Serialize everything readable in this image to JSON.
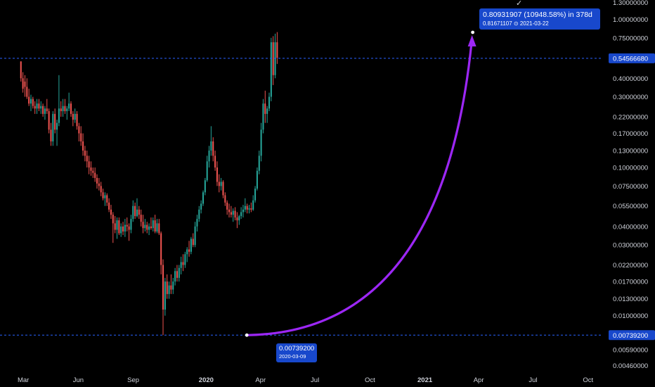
{
  "colors": {
    "background": "#000000",
    "up": "#26a69a",
    "down": "#ef5350",
    "arrow": "#9c27f5",
    "guide": "#2962ff",
    "axis_text": "#d1d4dc",
    "label_bg": "#1848cc"
  },
  "icons": {
    "top_marker": "check-icon"
  },
  "chart_data": {
    "type": "candlestick",
    "scale": "log",
    "y_axis_position": "right",
    "ylim": [
      0.0042,
      1.35
    ],
    "y_ticks": [
      {
        "value": 1.3,
        "label": "1.30000000"
      },
      {
        "value": 1.0,
        "label": "1.00000000"
      },
      {
        "value": 0.75,
        "label": "0.75000000"
      },
      {
        "value": 0.4,
        "label": "0.40000000"
      },
      {
        "value": 0.3,
        "label": "0.30000000"
      },
      {
        "value": 0.22,
        "label": "0.22000000"
      },
      {
        "value": 0.17,
        "label": "0.17000000"
      },
      {
        "value": 0.13,
        "label": "0.13000000"
      },
      {
        "value": 0.1,
        "label": "0.10000000"
      },
      {
        "value": 0.075,
        "label": "0.07500000"
      },
      {
        "value": 0.055,
        "label": "0.05500000"
      },
      {
        "value": 0.04,
        "label": "0.04000000"
      },
      {
        "value": 0.03,
        "label": "0.03000000"
      },
      {
        "value": 0.022,
        "label": "0.02200000"
      },
      {
        "value": 0.017,
        "label": "0.01700000"
      },
      {
        "value": 0.013,
        "label": "0.01300000"
      },
      {
        "value": 0.01,
        "label": "0.01000000"
      },
      {
        "value": 0.0059,
        "label": "0.00590000"
      },
      {
        "value": 0.0046,
        "label": "0.00460000"
      }
    ],
    "x_range": [
      "2019-01-21",
      "2021-10-26"
    ],
    "x_ticks": [
      {
        "date": "2019-03-01",
        "label": "Mar",
        "bold": false
      },
      {
        "date": "2019-06-01",
        "label": "Jun",
        "bold": false
      },
      {
        "date": "2019-09-01",
        "label": "Sep",
        "bold": false
      },
      {
        "date": "2020-01-01",
        "label": "2020",
        "bold": true
      },
      {
        "date": "2020-04-01",
        "label": "Apr",
        "bold": false
      },
      {
        "date": "2020-07-01",
        "label": "Jul",
        "bold": false
      },
      {
        "date": "2020-10-01",
        "label": "Oct",
        "bold": false
      },
      {
        "date": "2021-01-01",
        "label": "2021",
        "bold": true
      },
      {
        "date": "2021-04-01",
        "label": "Apr",
        "bold": false
      },
      {
        "date": "2021-07-01",
        "label": "Jul",
        "bold": false
      },
      {
        "date": "2021-10-01",
        "label": "Oct",
        "bold": false
      }
    ],
    "start_date": "2019-02-25",
    "interval_days": 3.35,
    "ohlc": [
      [
        0.52,
        0.52,
        0.38,
        0.4
      ],
      [
        0.4,
        0.44,
        0.32,
        0.34
      ],
      [
        0.38,
        0.42,
        0.3,
        0.35
      ],
      [
        0.35,
        0.4,
        0.29,
        0.3
      ],
      [
        0.3,
        0.34,
        0.26,
        0.27
      ],
      [
        0.27,
        0.31,
        0.24,
        0.29
      ],
      [
        0.29,
        0.3,
        0.25,
        0.26
      ],
      [
        0.26,
        0.28,
        0.23,
        0.25
      ],
      [
        0.25,
        0.29,
        0.23,
        0.27
      ],
      [
        0.27,
        0.29,
        0.24,
        0.25
      ],
      [
        0.25,
        0.28,
        0.23,
        0.26
      ],
      [
        0.26,
        0.27,
        0.22,
        0.23
      ],
      [
        0.23,
        0.26,
        0.21,
        0.25
      ],
      [
        0.25,
        0.29,
        0.23,
        0.24
      ],
      [
        0.24,
        0.25,
        0.17,
        0.18
      ],
      [
        0.18,
        0.2,
        0.14,
        0.15
      ],
      [
        0.15,
        0.24,
        0.14,
        0.23
      ],
      [
        0.23,
        0.25,
        0.17,
        0.18
      ],
      [
        0.18,
        0.21,
        0.14,
        0.2
      ],
      [
        0.2,
        0.42,
        0.19,
        0.25
      ],
      [
        0.25,
        0.28,
        0.22,
        0.24
      ],
      [
        0.24,
        0.29,
        0.22,
        0.26
      ],
      [
        0.26,
        0.29,
        0.23,
        0.24
      ],
      [
        0.24,
        0.26,
        0.21,
        0.25
      ],
      [
        0.25,
        0.32,
        0.24,
        0.27
      ],
      [
        0.27,
        0.28,
        0.22,
        0.23
      ],
      [
        0.23,
        0.24,
        0.19,
        0.21
      ],
      [
        0.21,
        0.25,
        0.2,
        0.23
      ],
      [
        0.23,
        0.24,
        0.18,
        0.19
      ],
      [
        0.19,
        0.2,
        0.15,
        0.17
      ],
      [
        0.17,
        0.19,
        0.14,
        0.15
      ],
      [
        0.15,
        0.17,
        0.12,
        0.13
      ],
      [
        0.13,
        0.14,
        0.11,
        0.12
      ],
      [
        0.12,
        0.13,
        0.1,
        0.11
      ],
      [
        0.11,
        0.12,
        0.09,
        0.1
      ],
      [
        0.1,
        0.11,
        0.088,
        0.095
      ],
      [
        0.095,
        0.1,
        0.085,
        0.092
      ],
      [
        0.092,
        0.1,
        0.08,
        0.085
      ],
      [
        0.085,
        0.09,
        0.072,
        0.078
      ],
      [
        0.078,
        0.085,
        0.07,
        0.075
      ],
      [
        0.075,
        0.08,
        0.064,
        0.068
      ],
      [
        0.068,
        0.072,
        0.06,
        0.062
      ],
      [
        0.062,
        0.068,
        0.055,
        0.065
      ],
      [
        0.065,
        0.067,
        0.055,
        0.058
      ],
      [
        0.058,
        0.062,
        0.05,
        0.052
      ],
      [
        0.052,
        0.056,
        0.045,
        0.048
      ],
      [
        0.048,
        0.05,
        0.031,
        0.042
      ],
      [
        0.042,
        0.047,
        0.036,
        0.038
      ],
      [
        0.038,
        0.046,
        0.033,
        0.044
      ],
      [
        0.044,
        0.046,
        0.035,
        0.036
      ],
      [
        0.036,
        0.042,
        0.034,
        0.04
      ],
      [
        0.04,
        0.043,
        0.035,
        0.037
      ],
      [
        0.037,
        0.045,
        0.034,
        0.041
      ],
      [
        0.041,
        0.046,
        0.037,
        0.04
      ],
      [
        0.04,
        0.042,
        0.032,
        0.038
      ],
      [
        0.038,
        0.048,
        0.036,
        0.045
      ],
      [
        0.045,
        0.06,
        0.043,
        0.055
      ],
      [
        0.055,
        0.058,
        0.045,
        0.047
      ],
      [
        0.047,
        0.062,
        0.046,
        0.052
      ],
      [
        0.052,
        0.055,
        0.045,
        0.048
      ],
      [
        0.048,
        0.052,
        0.04,
        0.043
      ],
      [
        0.043,
        0.048,
        0.036,
        0.039
      ],
      [
        0.039,
        0.045,
        0.037,
        0.041
      ],
      [
        0.041,
        0.043,
        0.036,
        0.038
      ],
      [
        0.038,
        0.042,
        0.035,
        0.04
      ],
      [
        0.04,
        0.046,
        0.038,
        0.039
      ],
      [
        0.039,
        0.046,
        0.037,
        0.044
      ],
      [
        0.044,
        0.048,
        0.036,
        0.037
      ],
      [
        0.037,
        0.045,
        0.036,
        0.042
      ],
      [
        0.042,
        0.045,
        0.035,
        0.036
      ],
      [
        0.036,
        0.037,
        0.019,
        0.022
      ],
      [
        0.022,
        0.024,
        0.0074,
        0.011
      ],
      [
        0.011,
        0.018,
        0.01,
        0.017
      ],
      [
        0.017,
        0.019,
        0.013,
        0.014
      ],
      [
        0.014,
        0.017,
        0.013,
        0.016
      ],
      [
        0.016,
        0.019,
        0.014,
        0.015
      ],
      [
        0.015,
        0.018,
        0.014,
        0.017
      ],
      [
        0.017,
        0.021,
        0.016,
        0.02
      ],
      [
        0.02,
        0.022,
        0.017,
        0.018
      ],
      [
        0.018,
        0.022,
        0.017,
        0.021
      ],
      [
        0.021,
        0.025,
        0.019,
        0.023
      ],
      [
        0.023,
        0.026,
        0.02,
        0.022
      ],
      [
        0.022,
        0.027,
        0.021,
        0.026
      ],
      [
        0.026,
        0.029,
        0.023,
        0.028
      ],
      [
        0.028,
        0.032,
        0.025,
        0.027
      ],
      [
        0.027,
        0.034,
        0.026,
        0.033
      ],
      [
        0.033,
        0.036,
        0.029,
        0.03
      ],
      [
        0.03,
        0.043,
        0.029,
        0.04
      ],
      [
        0.04,
        0.048,
        0.037,
        0.045
      ],
      [
        0.045,
        0.055,
        0.043,
        0.052
      ],
      [
        0.052,
        0.06,
        0.049,
        0.057
      ],
      [
        0.057,
        0.07,
        0.055,
        0.068
      ],
      [
        0.068,
        0.085,
        0.065,
        0.082
      ],
      [
        0.082,
        0.12,
        0.08,
        0.11
      ],
      [
        0.11,
        0.14,
        0.1,
        0.13
      ],
      [
        0.13,
        0.19,
        0.12,
        0.15
      ],
      [
        0.15,
        0.16,
        0.11,
        0.12
      ],
      [
        0.12,
        0.13,
        0.095,
        0.1
      ],
      [
        0.1,
        0.11,
        0.075,
        0.08
      ],
      [
        0.08,
        0.09,
        0.068,
        0.075
      ],
      [
        0.075,
        0.085,
        0.07,
        0.08
      ],
      [
        0.08,
        0.082,
        0.062,
        0.065
      ],
      [
        0.065,
        0.068,
        0.055,
        0.058
      ],
      [
        0.058,
        0.06,
        0.048,
        0.052
      ],
      [
        0.052,
        0.057,
        0.046,
        0.05
      ],
      [
        0.05,
        0.055,
        0.046,
        0.048
      ],
      [
        0.048,
        0.053,
        0.043,
        0.051
      ],
      [
        0.051,
        0.054,
        0.044,
        0.046
      ],
      [
        0.046,
        0.05,
        0.039,
        0.044
      ],
      [
        0.044,
        0.048,
        0.041,
        0.047
      ],
      [
        0.047,
        0.054,
        0.045,
        0.05
      ],
      [
        0.05,
        0.056,
        0.046,
        0.052
      ],
      [
        0.052,
        0.062,
        0.05,
        0.055
      ],
      [
        0.055,
        0.057,
        0.049,
        0.052
      ],
      [
        0.052,
        0.056,
        0.049,
        0.053
      ],
      [
        0.053,
        0.058,
        0.05,
        0.052
      ],
      [
        0.052,
        0.065,
        0.051,
        0.06
      ],
      [
        0.06,
        0.075,
        0.058,
        0.072
      ],
      [
        0.072,
        0.1,
        0.07,
        0.095
      ],
      [
        0.095,
        0.13,
        0.09,
        0.12
      ],
      [
        0.12,
        0.2,
        0.11,
        0.18
      ],
      [
        0.18,
        0.29,
        0.17,
        0.27
      ],
      [
        0.27,
        0.33,
        0.2,
        0.23
      ],
      [
        0.23,
        0.26,
        0.2,
        0.25
      ],
      [
        0.25,
        0.32,
        0.24,
        0.3
      ],
      [
        0.3,
        0.75,
        0.28,
        0.7
      ],
      [
        0.7,
        0.77,
        0.36,
        0.42
      ],
      [
        0.42,
        0.8,
        0.4,
        0.7
      ],
      [
        0.7,
        0.82,
        0.5,
        0.55
      ]
    ],
    "guide_lines": [
      {
        "value": 0.5456668,
        "label": "0.54566680"
      },
      {
        "value": 0.007392,
        "label": "0.00739200"
      }
    ],
    "measure": {
      "from_date": "2020-03-09",
      "from_price": 0.007392,
      "to_date": "2021-03-22",
      "to_price": 0.81671107,
      "change_text": "0.80931907 (10948.58%) in 378d",
      "sub_text": "0.81671107 ⊙ 2021-03-22",
      "low_price_text": "0.00739200",
      "low_date_text": "2020-03-09"
    }
  }
}
